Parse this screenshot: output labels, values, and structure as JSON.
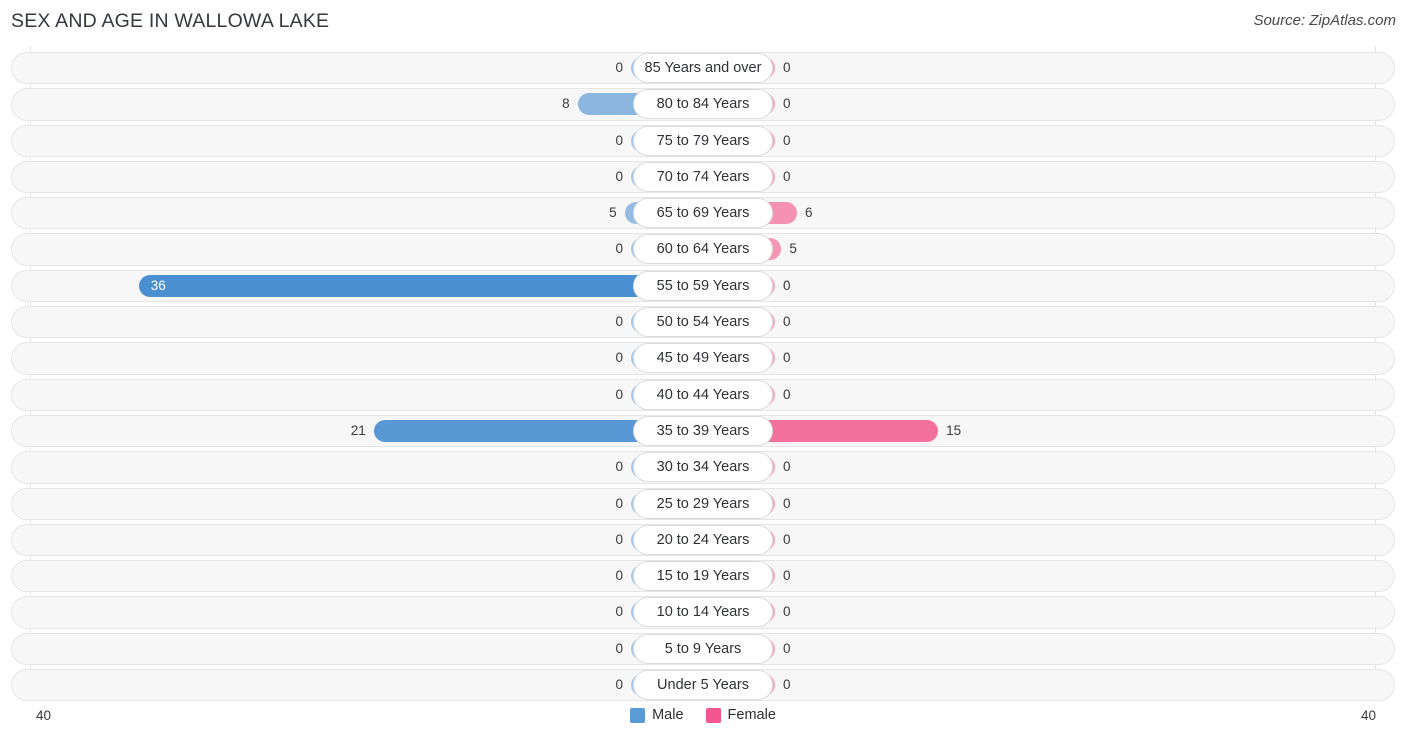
{
  "header": {
    "title": "SEX AND AGE IN WALLOWA LAKE",
    "source": "Source: ZipAtlas.com"
  },
  "legend": {
    "male_label": "Male",
    "female_label": "Female",
    "male_color": "#5b9bd5",
    "female_color": "#f4578f"
  },
  "axis": {
    "left_max": "40",
    "right_max": "40"
  },
  "colors": {
    "male_min": "#a8c8e8",
    "male_max": "#4a8fd0",
    "female_min": "#f7a8c0",
    "female_max": "#f04a86",
    "track_bg": "#f7f7f7",
    "track_border": "#e6e6e6",
    "gridline": "#e2e2e2",
    "pill_bg": "#ffffff",
    "pill_border": "#dcdcdc"
  },
  "chart_data": {
    "type": "bar",
    "subtype": "population-pyramid",
    "title": "SEX AND AGE IN WALLOWA LAKE",
    "xlabel": "",
    "ylabel": "",
    "xlim": [
      40,
      40
    ],
    "axis_max": 40,
    "grid": true,
    "legend_position": "bottom-center",
    "categories": [
      "85 Years and over",
      "80 to 84 Years",
      "75 to 79 Years",
      "70 to 74 Years",
      "65 to 69 Years",
      "60 to 64 Years",
      "55 to 59 Years",
      "50 to 54 Years",
      "45 to 49 Years",
      "40 to 44 Years",
      "35 to 39 Years",
      "30 to 34 Years",
      "25 to 29 Years",
      "20 to 24 Years",
      "15 to 19 Years",
      "10 to 14 Years",
      "5 to 9 Years",
      "Under 5 Years"
    ],
    "series": [
      {
        "name": "Male",
        "color": "#5b9bd5",
        "values": [
          0,
          8,
          0,
          0,
          5,
          0,
          36,
          0,
          0,
          0,
          21,
          0,
          0,
          0,
          0,
          0,
          0,
          0
        ]
      },
      {
        "name": "Female",
        "color": "#f4578f",
        "values": [
          0,
          0,
          0,
          0,
          6,
          5,
          0,
          0,
          0,
          0,
          15,
          0,
          0,
          0,
          0,
          0,
          0,
          0
        ]
      }
    ]
  }
}
